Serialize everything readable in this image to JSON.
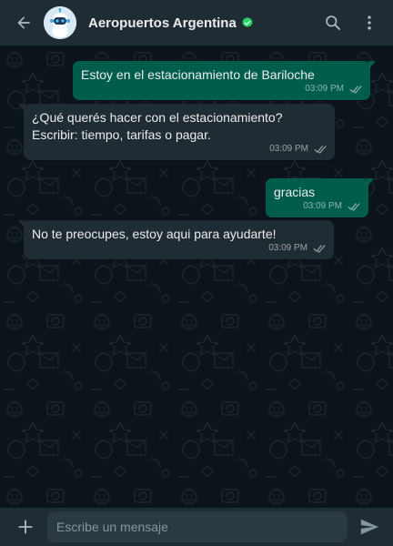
{
  "header": {
    "title": "Aeropuertos Argentina",
    "back_icon": "arrow-left-icon",
    "avatar_icon": "robot-avatar-icon",
    "verified_icon": "verified-check-icon",
    "search_icon": "search-icon",
    "menu_icon": "vertical-dots-icon"
  },
  "messages": [
    {
      "direction": "outgoing",
      "text": "Estoy en el estacionamiento de Bariloche",
      "time": "03:09 PM"
    },
    {
      "direction": "incoming",
      "text": "¿Qué querés hacer con el estacionamiento? Escribir: tiempo, tarifas o pagar.",
      "time": "03:09 PM"
    },
    {
      "direction": "outgoing",
      "text": "gracias",
      "time": "03:09 PM"
    },
    {
      "direction": "incoming",
      "text": "No te preocupes, estoy aqui para ayudarte!",
      "time": "03:09 PM"
    }
  ],
  "composer": {
    "placeholder": "Escribe un mensaje",
    "value": "",
    "attach_icon": "plus-icon",
    "send_icon": "send-icon"
  },
  "colors": {
    "header_bg": "#1f2c33",
    "chat_bg": "#0b141a",
    "outgoing_bubble": "#005c4b",
    "incoming_bubble": "#202c33",
    "verified": "#25d366",
    "text": "#e9edef",
    "meta_text": "#8696a0"
  }
}
